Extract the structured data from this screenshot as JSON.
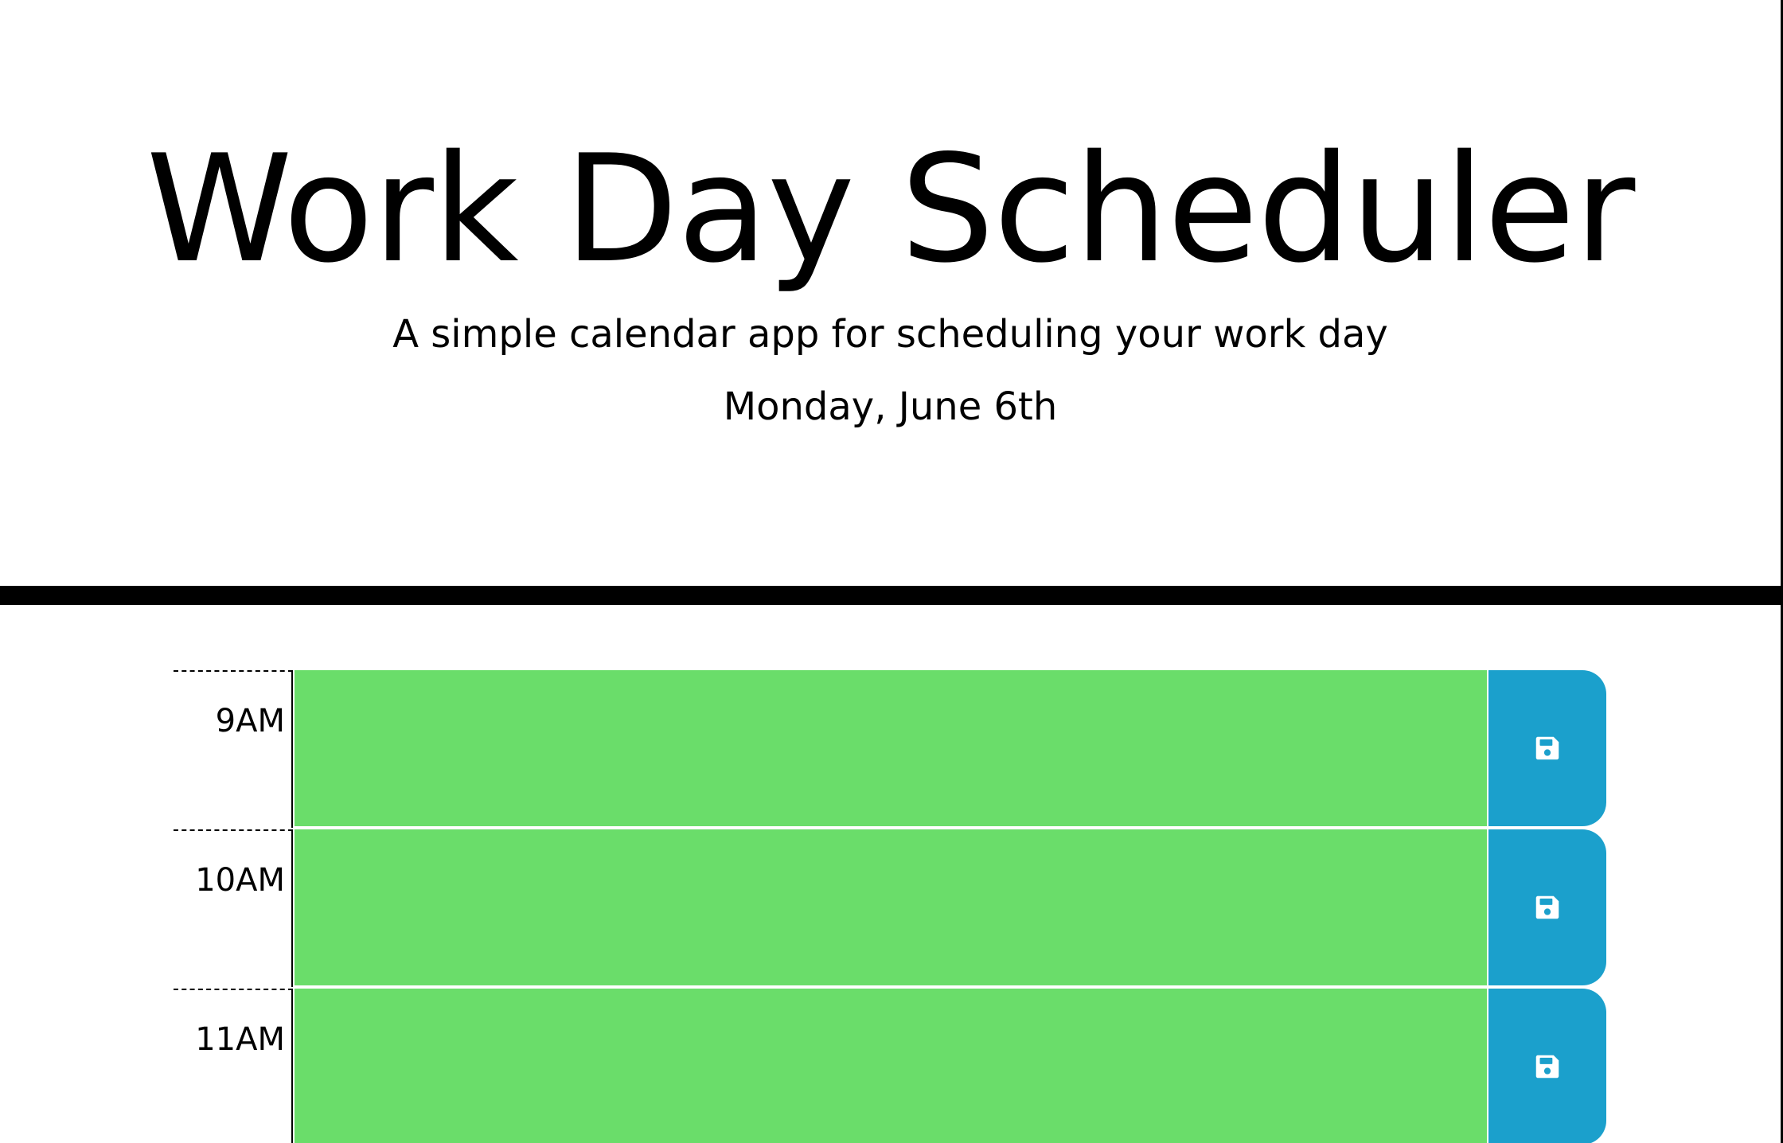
{
  "header": {
    "title": "Work Day Scheduler",
    "lead": "A simple calendar app for scheduling your work day",
    "current_day": "Monday, June 6th"
  },
  "time_blocks": [
    {
      "hour": "9AM",
      "text": "",
      "state": "future"
    },
    {
      "hour": "10AM",
      "text": "",
      "state": "future"
    },
    {
      "hour": "11AM",
      "text": "",
      "state": "future"
    }
  ],
  "colors": {
    "future": "#6add6a",
    "save_button": "#1ba0cc",
    "divider": "#000000"
  },
  "icons": {
    "save": "floppy-disk-icon"
  }
}
